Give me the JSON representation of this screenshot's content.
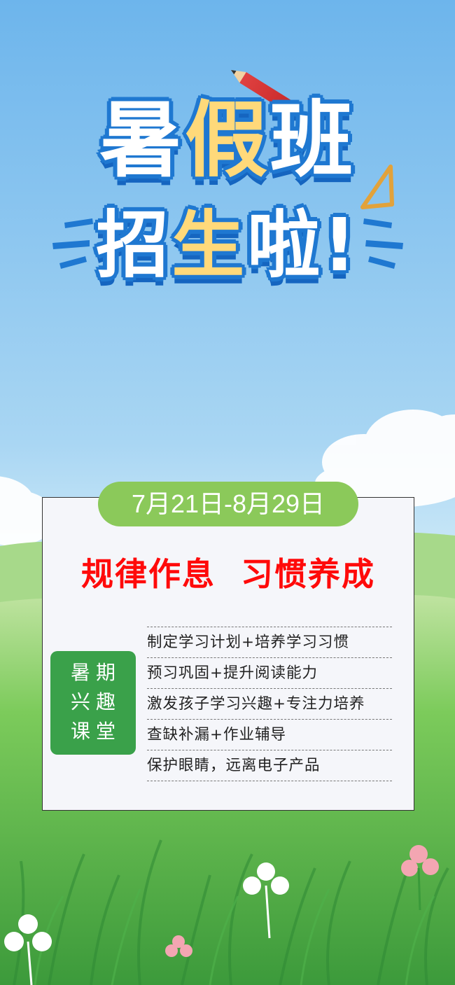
{
  "colors": {
    "sky_top": "#7cc0f0",
    "sky_bottom": "#cfe9f7",
    "grass": "#5cb84a",
    "title_outline": "#1f78d1",
    "title_accent": "#ffd97a",
    "date_pill": "#8bc95a",
    "headline": "#ff0a0a",
    "badge": "#3aa14a"
  },
  "title": {
    "line1_a": "暑",
    "line1_b": "假",
    "line1_c": "班",
    "line2_a": "招",
    "line2_b": "生",
    "line2_c": "啦!"
  },
  "date_range": "7月21日-8月29日",
  "headline": "规律作息  习惯养成",
  "badge": [
    "暑期",
    "兴趣",
    "课堂"
  ],
  "features": [
    "制定学习计划+培养学习习惯",
    "预习巩固+提升阅读能力",
    "激发孩子学习兴趣+专注力培养",
    "查缺补漏+作业辅导",
    "保护眼睛，远离电子产品"
  ],
  "decorations": [
    "pencil-icon",
    "triangle-ruler-icon",
    "flower-icon"
  ]
}
